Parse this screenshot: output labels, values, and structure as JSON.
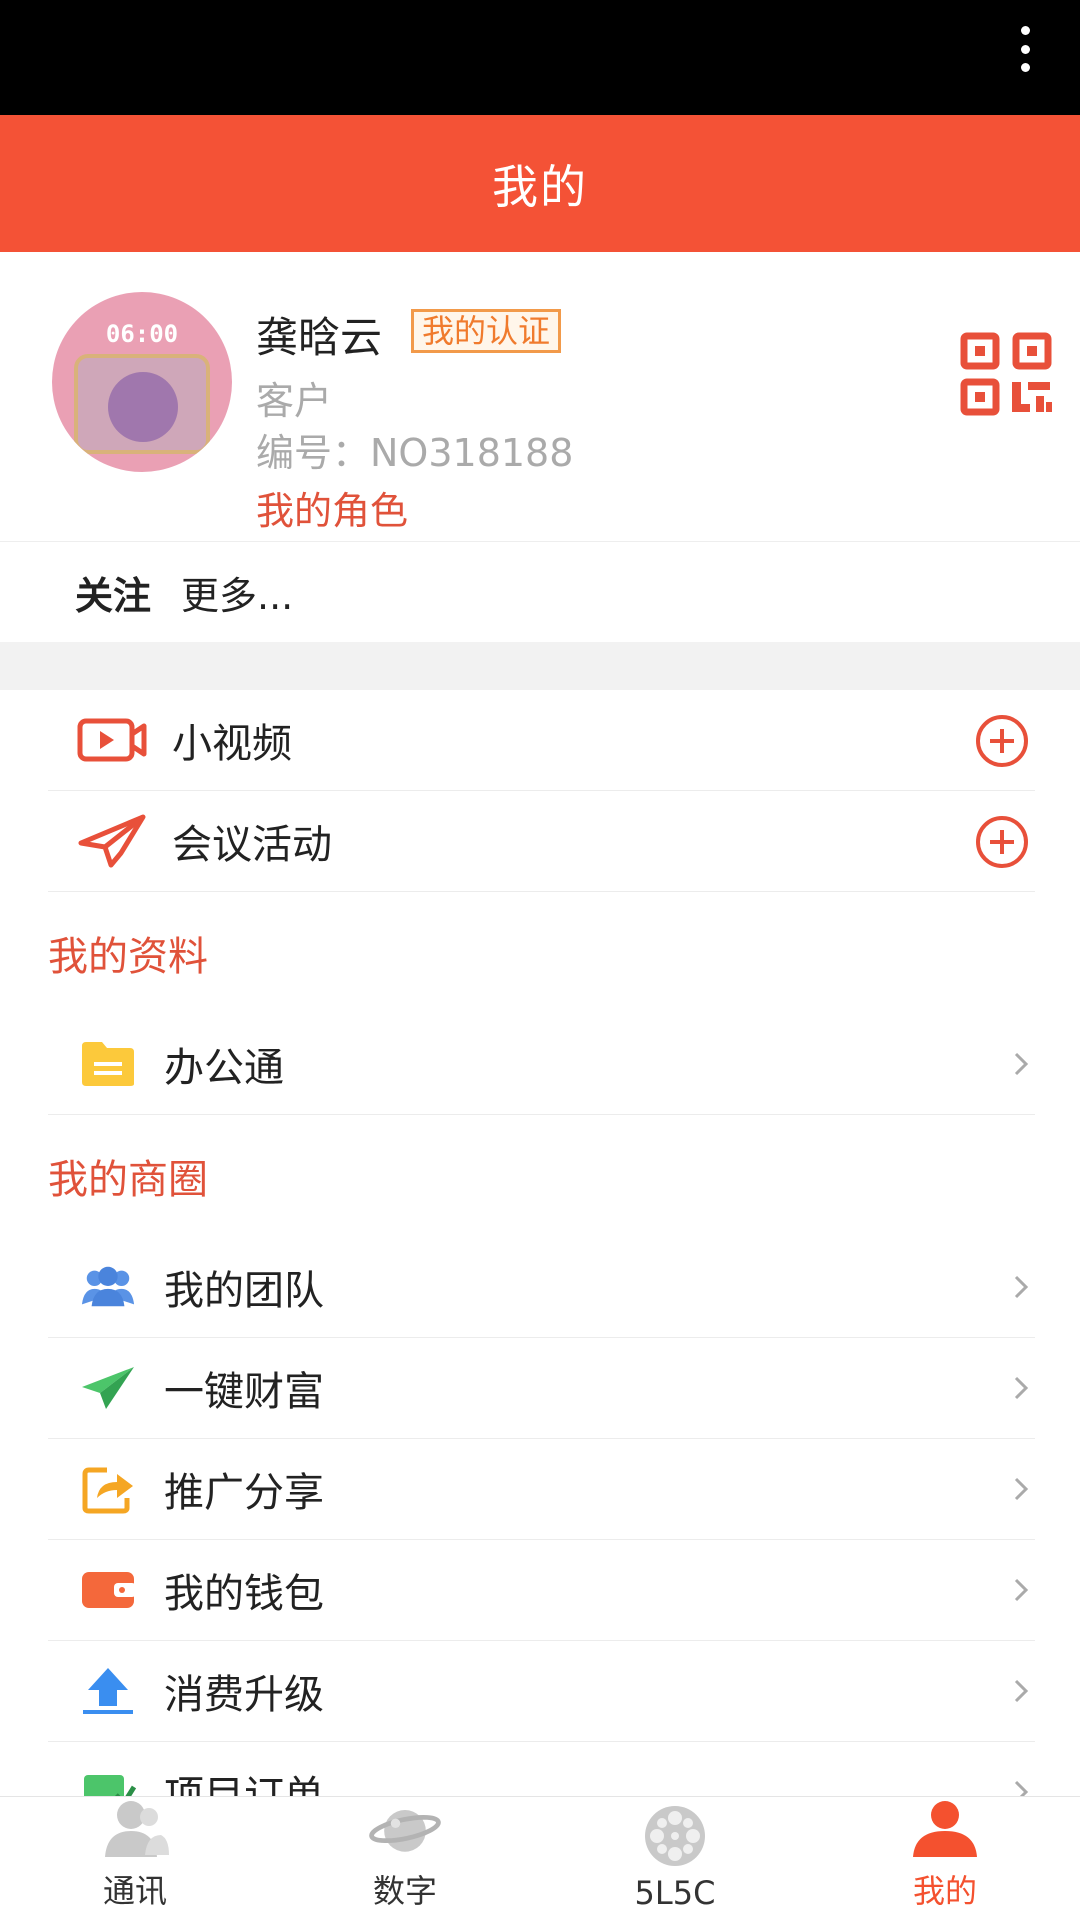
{
  "header": {
    "title": "我的"
  },
  "profile": {
    "avatar_clock": "06:00",
    "name": "龚晗云",
    "cert_badge": "我的认证",
    "role": "客户",
    "number": "编号：NO318188",
    "my_role_link": "我的角色"
  },
  "follow": {
    "label": "关注",
    "more": "更多..."
  },
  "quick_actions": [
    {
      "label": "小视频",
      "icon": "video-icon"
    },
    {
      "label": "会议活动",
      "icon": "paper-plane-icon"
    }
  ],
  "sections": {
    "materials": {
      "title": "我的资料",
      "items": [
        {
          "label": "办公通",
          "icon": "folder-icon"
        }
      ]
    },
    "business": {
      "title": "我的商圈",
      "items": [
        {
          "label": "我的团队",
          "icon": "team-icon"
        },
        {
          "label": "一键财富",
          "icon": "send-icon"
        },
        {
          "label": "推广分享",
          "icon": "share-icon"
        },
        {
          "label": "我的钱包",
          "icon": "wallet-icon"
        },
        {
          "label": "消费升级",
          "icon": "upload-icon"
        },
        {
          "label": "项目订单",
          "icon": "order-icon"
        }
      ]
    }
  },
  "tabs": [
    {
      "label": "通讯",
      "icon": "contacts-icon"
    },
    {
      "label": "数字",
      "icon": "planet-icon"
    },
    {
      "label": "5L5C",
      "icon": "film-reel-icon"
    },
    {
      "label": "我的",
      "icon": "person-icon",
      "active": true
    }
  ],
  "colors": {
    "primary": "#f45236",
    "accent_text": "#e0523a",
    "badge": "#f07b2d"
  }
}
